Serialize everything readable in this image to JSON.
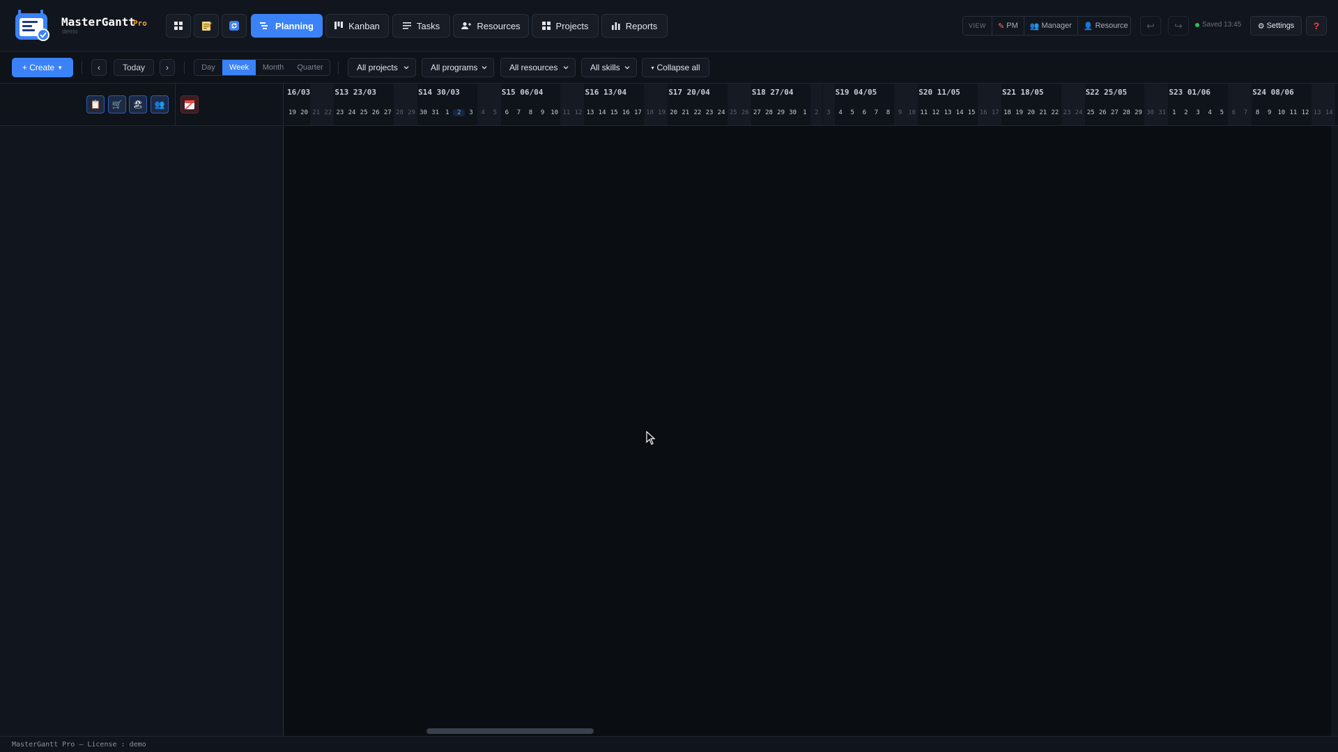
{
  "app": {
    "name": "MasterGantt",
    "edition": "Pro",
    "subtitle": "demo"
  },
  "nav": {
    "tabs": [
      {
        "label": "Planning",
        "active": true
      },
      {
        "label": "Kanban"
      },
      {
        "label": "Tasks"
      },
      {
        "label": "Resources"
      },
      {
        "label": "Projects"
      },
      {
        "label": "Reports"
      }
    ]
  },
  "view": {
    "label": "VIEW",
    "options": [
      "PM",
      "Manager",
      "Resource"
    ]
  },
  "status": {
    "saved": "Saved 13:45"
  },
  "header_actions": {
    "settings": "Settings",
    "help": "?"
  },
  "toolbar": {
    "create": "+ Create",
    "prev": "‹",
    "today": "Today",
    "next": "›",
    "scales": [
      "Day",
      "Week",
      "Month",
      "Quarter"
    ],
    "active_scale": "Week",
    "filters": {
      "projects": "All projects",
      "programs": "All programs",
      "resources": "All resources",
      "skills": "All skills"
    },
    "collapse": "Collapse all"
  },
  "timeline": {
    "weeks": [
      "16/03",
      "S13 23/03",
      "S14 30/03",
      "S15 06/04",
      "S16 13/04",
      "S17 20/04",
      "S18 27/04",
      "S19 04/05",
      "S20 11/05",
      "S21 18/05",
      "S22 25/05",
      "S23 01/06",
      "S24 08/06"
    ],
    "days": [
      "19",
      "20",
      "21",
      "22",
      "23",
      "24",
      "25",
      "26",
      "27",
      "28",
      "29",
      "30",
      "31",
      "1",
      "2",
      "3",
      "4",
      "5",
      "6",
      "7",
      "8",
      "9",
      "10",
      "11",
      "12",
      "13",
      "14",
      "15",
      "16",
      "17",
      "18",
      "19",
      "20",
      "21",
      "22",
      "23",
      "24",
      "25",
      "26",
      "27",
      "28",
      "29",
      "30",
      "1",
      "2",
      "3",
      "4",
      "5",
      "6",
      "7",
      "8",
      "9",
      "10",
      "11",
      "12",
      "13",
      "14",
      "15",
      "16",
      "17",
      "18",
      "19",
      "20",
      "21",
      "22",
      "23",
      "24",
      "25",
      "26",
      "27",
      "28",
      "29",
      "30",
      "31",
      "1",
      "2",
      "3",
      "4",
      "5",
      "6",
      "7",
      "8",
      "9",
      "10",
      "11",
      "12",
      "13",
      "14"
    ],
    "today": "2"
  },
  "footer": {
    "text": "MasterGantt Pro — License : demo"
  }
}
